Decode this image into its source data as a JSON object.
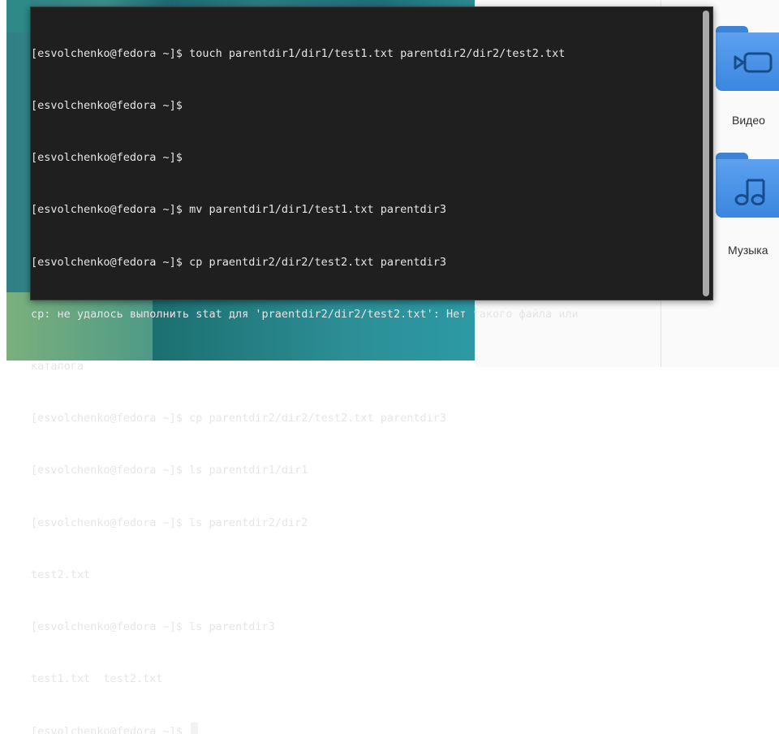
{
  "terminal": {
    "lines": [
      "[esvolchenko@fedora ~]$ touch parentdir1/dir1/test1.txt parentdir2/dir2/test2.txt",
      "[esvolchenko@fedora ~]$",
      "[esvolchenko@fedora ~]$",
      "[esvolchenko@fedora ~]$ mv parentdir1/dir1/test1.txt parentdir3",
      "[esvolchenko@fedora ~]$ cp praentdir2/dir2/test2.txt parentdir3",
      "cp: не удалось выполнить stat для 'praentdir2/dir2/test2.txt': Нет такого файла или",
      "каталога",
      "[esvolchenko@fedora ~]$ cp parentdir2/dir2/test2.txt parentdir3",
      "[esvolchenko@fedora ~]$ ls parentdir1/dir1",
      "[esvolchenko@fedora ~]$ ls parentdir2/dir2",
      "test2.txt",
      "[esvolchenko@fedora ~]$ ls parentdir3",
      "test1.txt  test2.txt"
    ],
    "prompt": "[esvolchenko@fedora ~]$ "
  },
  "file_manager": {
    "folders": [
      {
        "label": "Видео",
        "icon": "video-icon"
      },
      {
        "label": "Музыка",
        "icon": "music-note-icon"
      }
    ]
  },
  "colors": {
    "terminal_bg": "#1f1f1f",
    "terminal_fg": "#e6e6e6",
    "folder_blue": "#3b86e0"
  }
}
